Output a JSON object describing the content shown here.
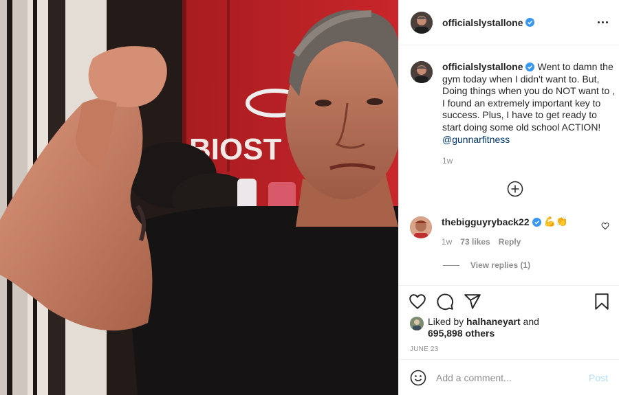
{
  "post": {
    "author": {
      "username": "officialslystallone",
      "verified": true,
      "avatar_icon": "profile-photo"
    },
    "more_icon": "ellipsis-icon",
    "caption": {
      "username": "officialslystallone",
      "text": "Went to damn the gym today when I didn't want to. But, Doing things when you do NOT want to , I found an extremely important key to success. Plus, I have to get ready to start doing some old school ACTION!",
      "mention": "@gunnarfitness",
      "time": "1w"
    },
    "load_more_icon": "plus-circle-icon",
    "comments": [
      {
        "username": "thebigguyryback22",
        "verified": true,
        "emoji": "💪👏",
        "time": "1w",
        "likes": "73 likes",
        "reply_label": "Reply",
        "view_replies": "View replies (1)"
      }
    ],
    "likes": {
      "prefix": "Liked by",
      "user": "halhaneyart",
      "and": "and",
      "count": "695,898 others"
    },
    "date": "JUNE 23",
    "add_comment": {
      "placeholder": "Add a comment...",
      "post_label": "Post"
    },
    "colors": {
      "verified_blue": "#3897f0",
      "mention": "#00376b",
      "post_button_disabled": "#b2dffc",
      "text": "#262626",
      "muted": "#8e8e8e"
    }
  }
}
